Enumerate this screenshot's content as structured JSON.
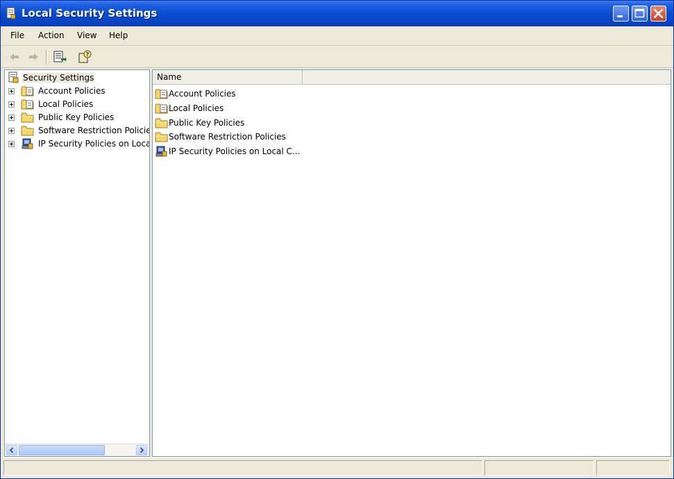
{
  "window": {
    "title": "Local Security Settings"
  },
  "menu": {
    "items": [
      "File",
      "Action",
      "View",
      "Help"
    ]
  },
  "toolbar": {
    "buttons": [
      {
        "icon": "back-arrow-icon"
      },
      {
        "icon": "forward-arrow-icon"
      },
      {
        "icon": "export-list-icon"
      },
      {
        "icon": "help-icon"
      }
    ]
  },
  "tree": {
    "root": {
      "label": "Security Settings",
      "icon": "security-settings-icon"
    },
    "items": [
      {
        "label": "Account Policies",
        "icon": "policy-folder-icon"
      },
      {
        "label": "Local Policies",
        "icon": "policy-folder-icon"
      },
      {
        "label": "Public Key Policies",
        "icon": "folder-icon"
      },
      {
        "label": "Software Restriction Policie",
        "icon": "folder-icon"
      },
      {
        "label": "IP Security Policies on Loca",
        "icon": "ip-security-icon"
      }
    ]
  },
  "list": {
    "columns": [
      "Name"
    ],
    "rows": [
      {
        "name": "Account Policies",
        "icon": "policy-folder-icon"
      },
      {
        "name": "Local Policies",
        "icon": "policy-folder-icon"
      },
      {
        "name": "Public Key Policies",
        "icon": "folder-icon"
      },
      {
        "name": "Software Restriction Policies",
        "icon": "folder-icon"
      },
      {
        "name": "IP Security Policies on Local C...",
        "icon": "ip-security-icon"
      }
    ]
  },
  "colors": {
    "titlebar": "#0a4ccf",
    "chrome": "#ece9d8",
    "pane_border": "#7f9db9",
    "folder": "#f5d76e"
  }
}
